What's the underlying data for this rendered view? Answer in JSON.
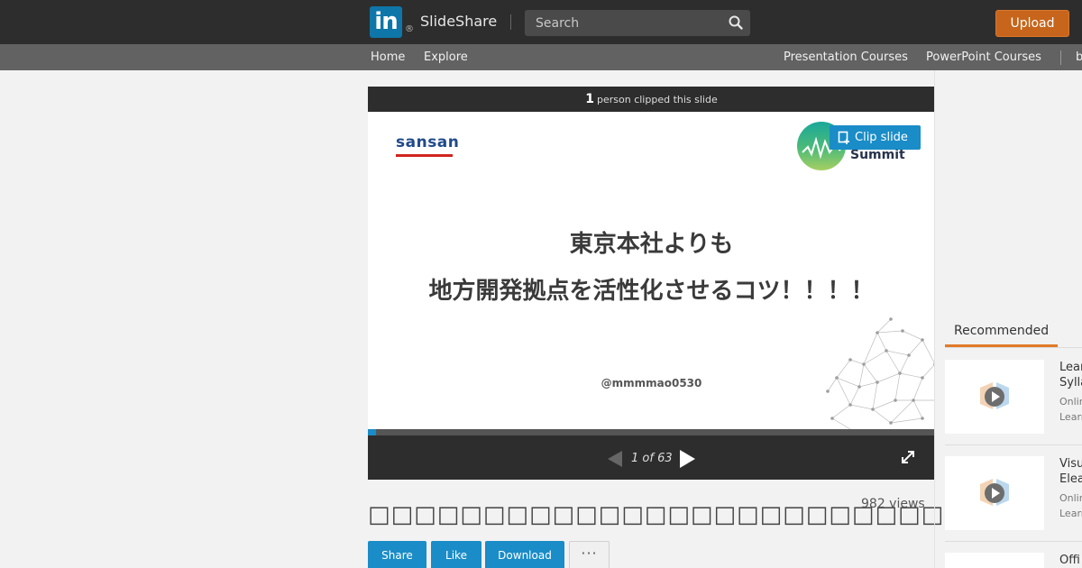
{
  "header": {
    "logo_mark": "in",
    "logo_reg": "®",
    "logo_text": "SlideShare",
    "search_placeholder": "Search",
    "upload_label": "Upload"
  },
  "nav": {
    "home": "Home",
    "explore": "Explore",
    "presentation_courses": "Presentation Courses",
    "powerpoint_courses": "PowerPoint Courses",
    "overflow": "b"
  },
  "player": {
    "clip_count": "1",
    "clip_text": "person clipped this slide",
    "clip_button": "Clip slide",
    "slide": {
      "brand": "sansan",
      "summit_text": "Summit",
      "line1": "東京本社よりも",
      "line2": "地方開発拠点を活性化させるコツ！！！！",
      "handle": "@mmmmao0530"
    },
    "progress_fraction": 0.015,
    "page_indicator": "1 of 63"
  },
  "document": {
    "title": "□□□□□□□□□□□□□□□□□□□□□□□□□□□□□",
    "views": "982 views",
    "actions": {
      "share": "Share",
      "like": "Like",
      "download": "Download",
      "more": "···"
    }
  },
  "sidebar": {
    "tab": "Recommended",
    "items": [
      {
        "title_line1": "Lear",
        "title_line2": "Sylla",
        "meta1": "Onlin",
        "meta2": "Learn"
      },
      {
        "title_line1": "Visu",
        "title_line2": "Elea",
        "meta1": "Onlin",
        "meta2": "Learn"
      },
      {
        "title_line1": "Offi"
      }
    ]
  },
  "colors": {
    "linkedin_blue": "#0e76a8",
    "upload_orange": "#c6651b",
    "action_blue": "#1a8cc7",
    "sansan_red": "#d0241d",
    "recommended_accent": "#e07b2a"
  }
}
